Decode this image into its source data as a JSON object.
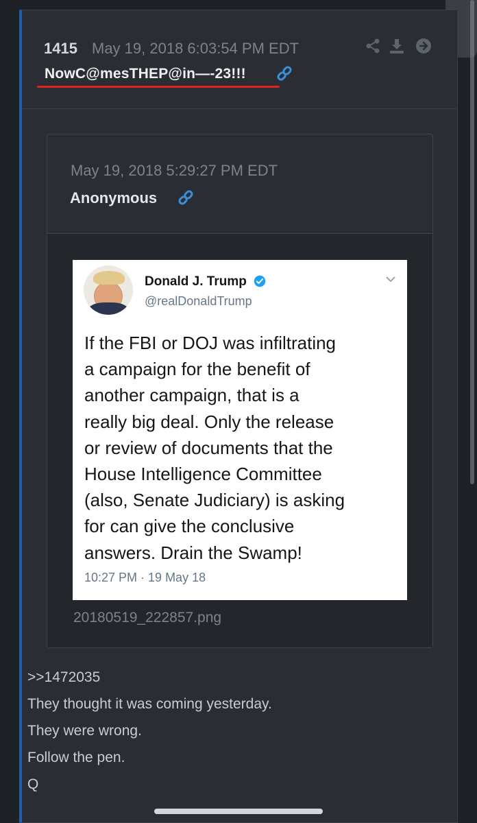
{
  "post": {
    "number": "1415",
    "timestamp": "May 19, 2018 6:03:54 PM EDT",
    "title": "NowC@mesTHEP@in—-23!!!",
    "icons": [
      "share-icon",
      "download-icon",
      "arrow-right-icon",
      "link-icon"
    ]
  },
  "quoted_post": {
    "timestamp": "May 19, 2018 5:29:27 PM EDT",
    "author": "Anonymous",
    "attachment": {
      "filename": "20180519_222857.png",
      "tweet": {
        "name": "Donald J. Trump",
        "handle": "@realDonaldTrump",
        "text_lines": [
          "If the FBI or DOJ was infiltrating",
          "a campaign for the benefit of",
          "another campaign, that is a",
          "really big deal. Only the release",
          "or review of documents that the",
          "House Intelligence Committee",
          "(also, Senate Judiciary) is asking",
          "for can give the conclusive",
          "answers. Drain the Swamp!"
        ],
        "time": "10:27 PM · 19 May 18"
      }
    }
  },
  "body": {
    "lines": [
      ">>1472035",
      "They thought it was coming yesterday.",
      "They were wrong.",
      "Follow the pen.",
      "Q"
    ]
  },
  "colors": {
    "background": "#1e2227",
    "panel": "#2a2e34",
    "accent_blue": "#1f5ea8",
    "link_blue": "#3b8fd9",
    "underline_red": "#e1231f",
    "verified_blue": "#1da1f2"
  }
}
